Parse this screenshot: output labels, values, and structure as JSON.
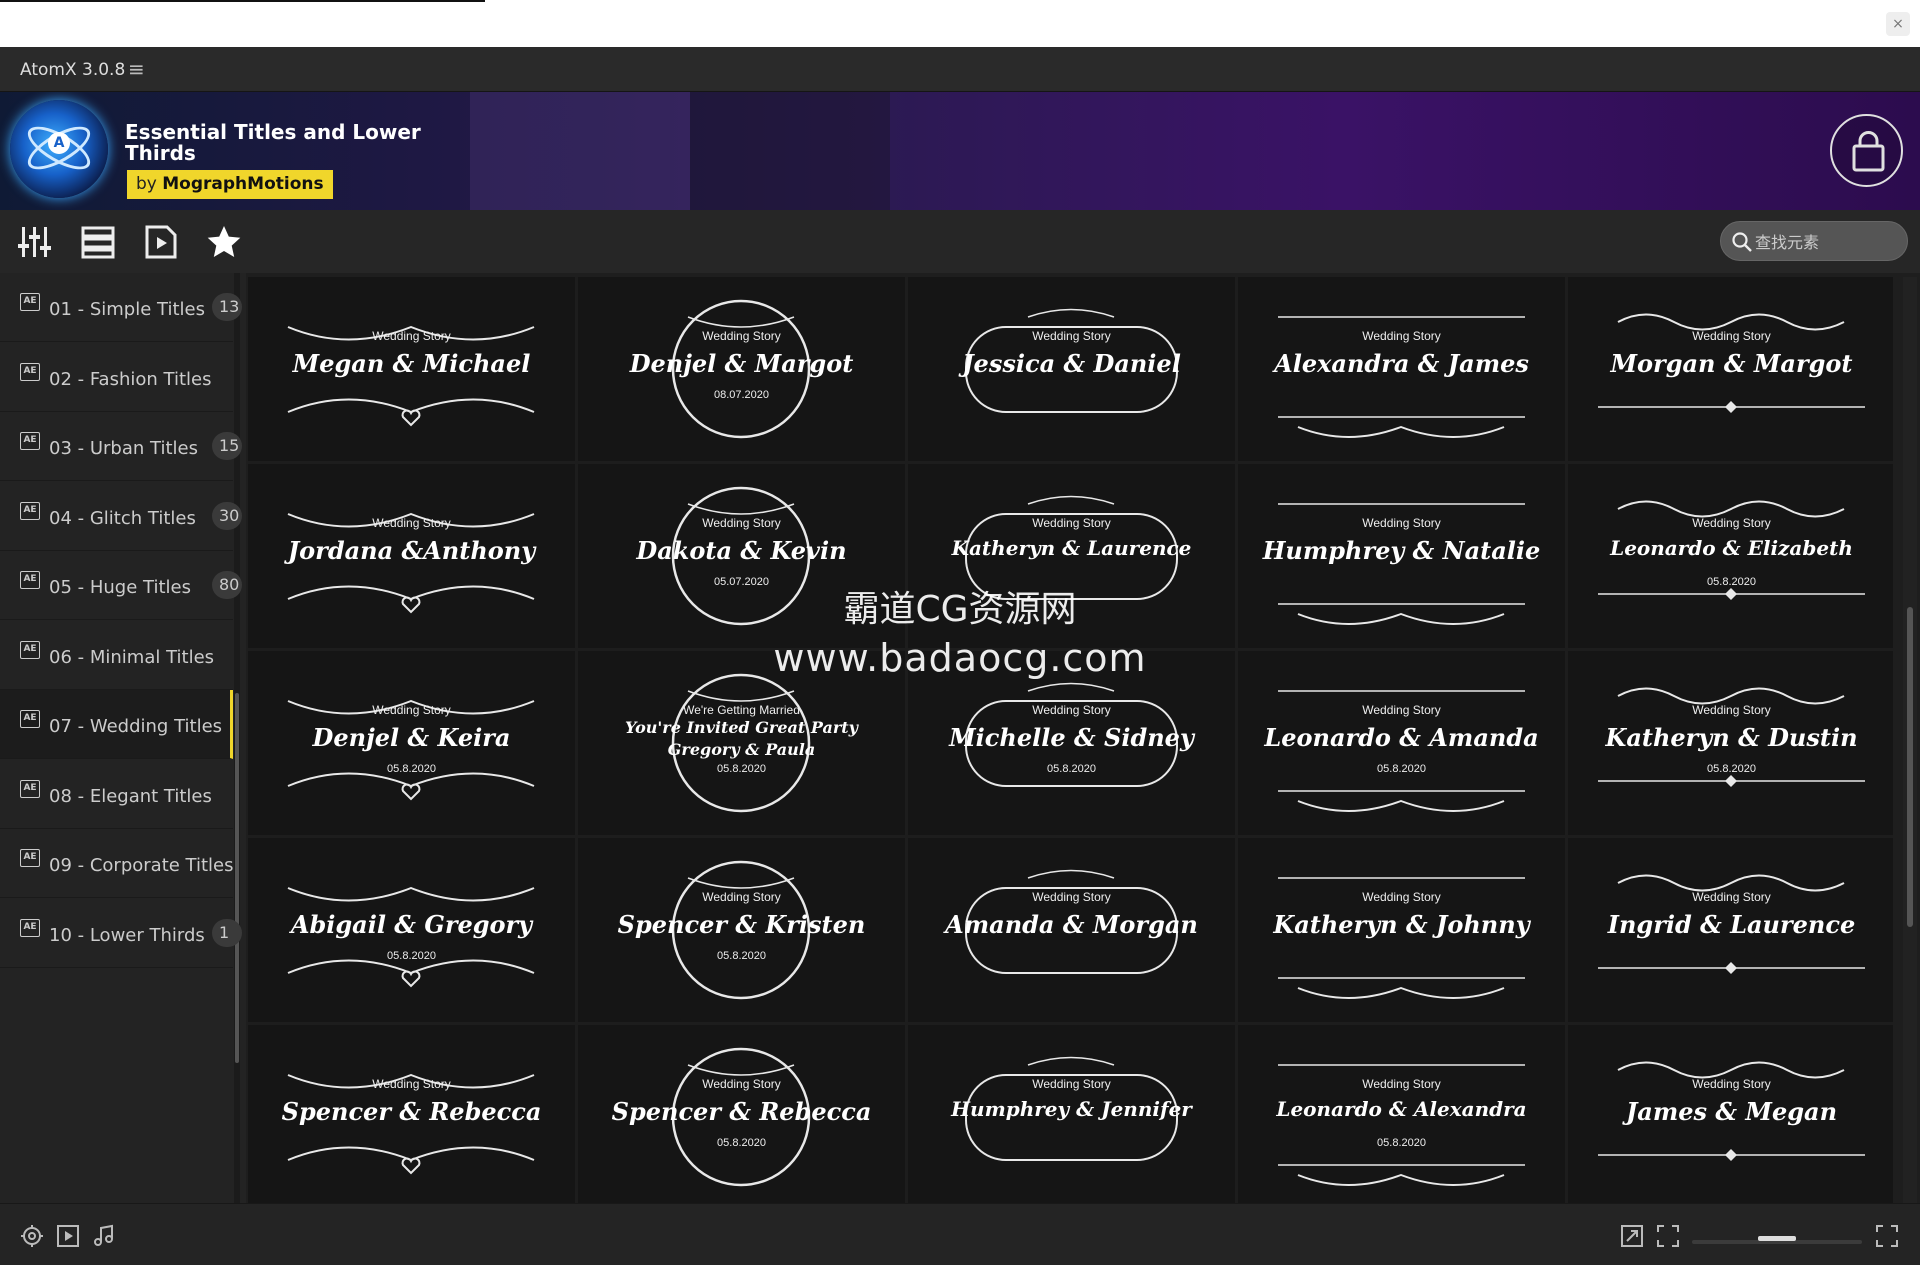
{
  "window": {
    "close_label": "×"
  },
  "app": {
    "title": "AtomX 3.0.8",
    "menu_icon": "hamburger-icon"
  },
  "banner": {
    "pack_title": "Essential Titles and Lower Thirds",
    "by_prefix": "by",
    "author": "MographMotions",
    "brand_color": "#f0d62b",
    "cart_icon": "shopping-bag-icon"
  },
  "toolbar": {
    "icons": [
      "sliders-icon",
      "list-view-icon",
      "video-preview-icon",
      "favorites-star-icon"
    ],
    "search_placeholder": "查找元素"
  },
  "sidebar": {
    "categories": [
      {
        "label": "01 - Simple Titles",
        "count": "13"
      },
      {
        "label": "02 - Fashion Titles",
        "count": ""
      },
      {
        "label": "03 - Urban Titles",
        "count": "15"
      },
      {
        "label": "04 - Glitch Titles",
        "count": "30"
      },
      {
        "label": "05 - Huge Titles",
        "count": "80"
      },
      {
        "label": "06 - Minimal Titles",
        "count": ""
      },
      {
        "label": "07 - Wedding Titles",
        "count": "",
        "active": true
      },
      {
        "label": "08 - Elegant Titles",
        "count": ""
      },
      {
        "label": "09 - Corporate Titles",
        "count": ""
      },
      {
        "label": "10 - Lower Thirds",
        "count": "1"
      }
    ]
  },
  "grid": {
    "tiles": [
      {
        "heading": "Wedding Story",
        "names": "Megan & Michael",
        "date": ""
      },
      {
        "heading": "Wedding Story",
        "names": "Denjel & Margot",
        "date": "08.07.2020"
      },
      {
        "heading": "Wedding Story",
        "names": "Jessica & Daniel",
        "date": ""
      },
      {
        "heading": "Wedding Story",
        "names": "Alexandra & James",
        "date": ""
      },
      {
        "heading": "Wedding Story",
        "names": "Morgan & Margot",
        "date": ""
      },
      {
        "heading": "Wedding Story",
        "names": "Jordana &Anthony",
        "date": ""
      },
      {
        "heading": "Wedding Story",
        "names": "Dakota & Kevin",
        "date": "05.07.2020"
      },
      {
        "heading": "Wedding Story",
        "names": "Katheryn & Laurence",
        "date": ""
      },
      {
        "heading": "Wedding Story",
        "names": "Humphrey & Natalie",
        "date": ""
      },
      {
        "heading": "Wedding Story",
        "names": "Leonardo & Elizabeth",
        "date": "05.8.2020"
      },
      {
        "heading": "Wedding Story",
        "names": "Denjel & Keira",
        "date": "05.8.2020"
      },
      {
        "heading": "We're Getting Married",
        "names": "You're Invited Great Party\nGregory & Paula",
        "date": "05.8.2020"
      },
      {
        "heading": "Wedding Story",
        "names": "Michelle & Sidney",
        "date": "05.8.2020"
      },
      {
        "heading": "Wedding Story",
        "names": "Leonardo & Amanda",
        "date": "05.8.2020"
      },
      {
        "heading": "Wedding Story",
        "names": "Katheryn & Dustin",
        "date": "05.8.2020"
      },
      {
        "heading": "",
        "names": "Abigail & Gregory",
        "date": "05.8.2020"
      },
      {
        "heading": "Wedding Story",
        "names": "Spencer & Kristen",
        "date": "05.8.2020"
      },
      {
        "heading": "Wedding Story",
        "names": "Amanda & Morgan",
        "date": ""
      },
      {
        "heading": "Wedding Story",
        "names": "Katheryn & Johnny",
        "date": ""
      },
      {
        "heading": "Wedding Story",
        "names": "Ingrid & Laurence",
        "date": ""
      },
      {
        "heading": "Wedding Story",
        "names": "Spencer & Rebecca",
        "date": ""
      },
      {
        "heading": "Wedding Story",
        "names": "Spencer & Rebecca",
        "date": "05.8.2020"
      },
      {
        "heading": "Wedding Story",
        "names": "Humphrey & Jennifer",
        "date": ""
      },
      {
        "heading": "Wedding Story",
        "names": "Leonardo & Alexandra",
        "date": "05.8.2020"
      },
      {
        "heading": "Wedding Story",
        "names": "James & Megan",
        "date": ""
      }
    ]
  },
  "watermark": {
    "line1": "霸道CG资源网",
    "line2": "www.badaocg.com"
  },
  "statusbar": {
    "left_icons": [
      "target-icon",
      "play-preview-icon",
      "music-note-icon"
    ],
    "right_icons": [
      "expand-icon",
      "fullscreen-icon",
      "fit-icon"
    ],
    "zoom_fraction": 0.5
  }
}
